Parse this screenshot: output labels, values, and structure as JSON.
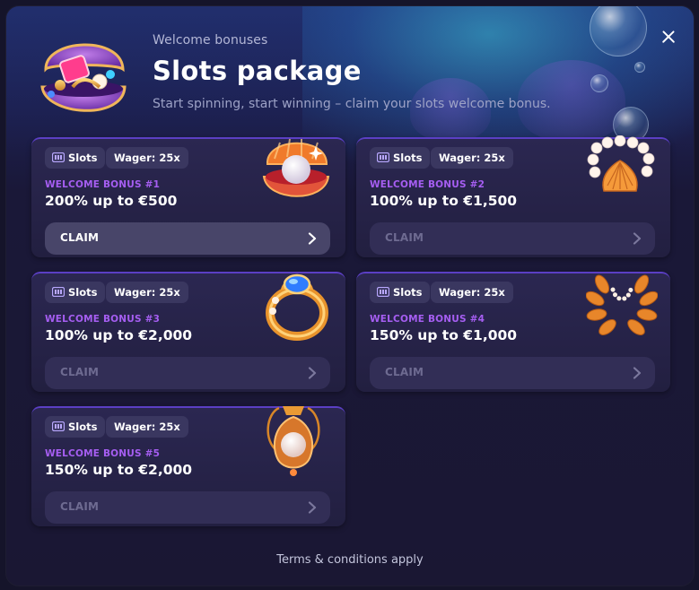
{
  "header": {
    "eyebrow": "Welcome bonuses",
    "title": "Slots package",
    "subtitle": "Start spinning, start winning – claim your slots welcome bonus."
  },
  "icons": {
    "close": "close-icon",
    "hero": "treasure-clam-icon",
    "chip": "slot-machine-icon",
    "chevron": "chevron-right-icon"
  },
  "colors": {
    "accent_purple": "#a65ef2",
    "card_border": "#5b3fc4"
  },
  "cards": [
    {
      "tag": "Slots",
      "wager": "Wager: 25x",
      "label": "WELCOME BONUS #1",
      "amount": "200% up to €500",
      "claim": "CLAIM",
      "claim_enabled": true,
      "art": "pearl-shell-icon"
    },
    {
      "tag": "Slots",
      "wager": "Wager: 25x",
      "label": "WELCOME BONUS #2",
      "amount": "100% up to €1,500",
      "claim": "CLAIM",
      "claim_enabled": false,
      "art": "pearl-bracelet-icon"
    },
    {
      "tag": "Slots",
      "wager": "Wager: 25x",
      "label": "WELCOME BONUS #3",
      "amount": "100% up to €2,000",
      "claim": "CLAIM",
      "claim_enabled": false,
      "art": "sapphire-ring-icon"
    },
    {
      "tag": "Slots",
      "wager": "Wager: 25x",
      "label": "WELCOME BONUS #4",
      "amount": "150% up to €1,000",
      "claim": "CLAIM",
      "claim_enabled": false,
      "art": "laurel-wreath-icon"
    },
    {
      "tag": "Slots",
      "wager": "Wager: 25x",
      "label": "WELCOME BONUS #5",
      "amount": "150% up to €2,000",
      "claim": "CLAIM",
      "claim_enabled": false,
      "art": "pearl-amulet-icon"
    }
  ],
  "footer": {
    "terms": "Terms & conditions apply"
  }
}
